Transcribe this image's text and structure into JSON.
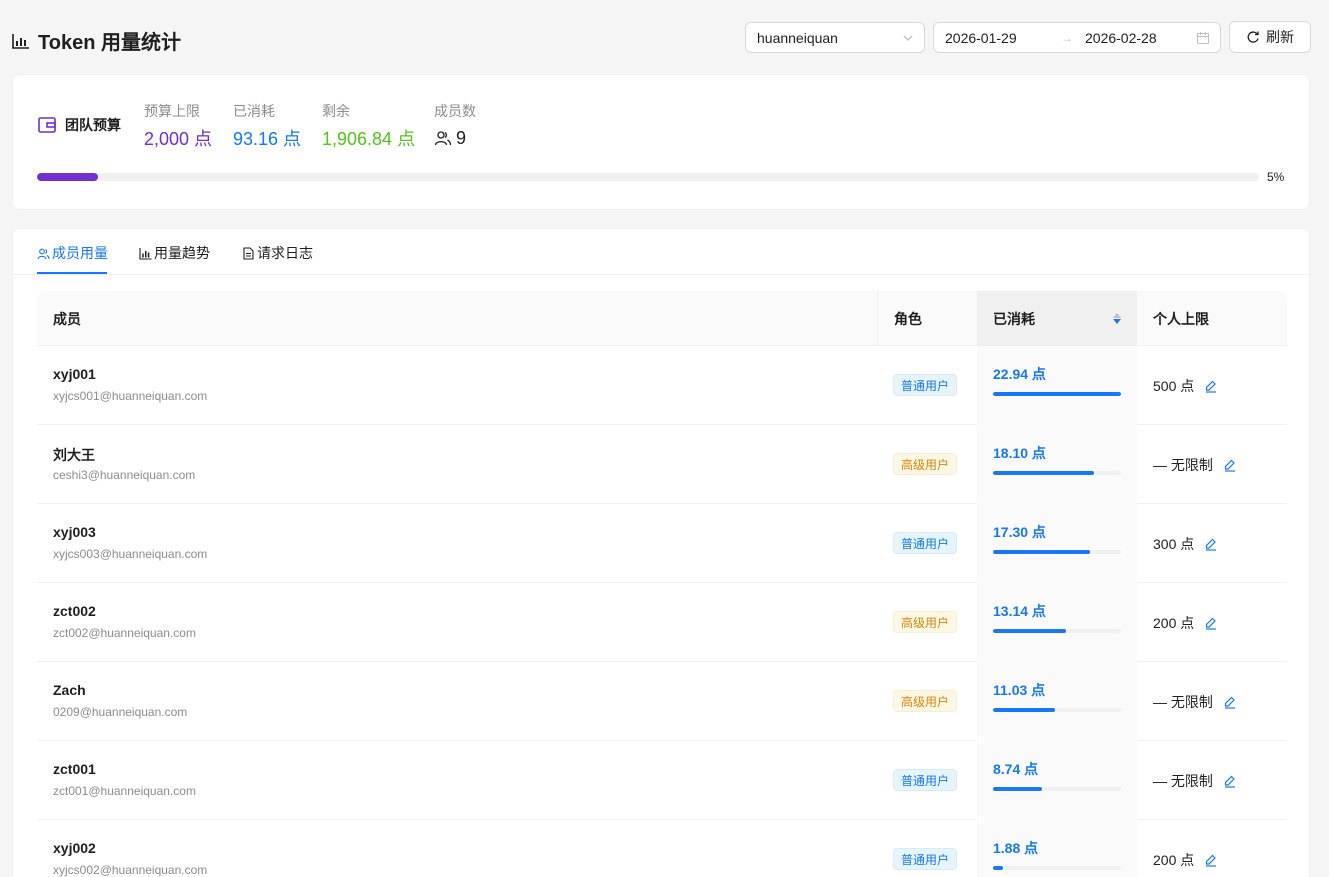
{
  "header": {
    "title": "Token 用量统计",
    "team_select": "huanneiquan",
    "date_start": "2026-01-29",
    "date_end": "2026-02-28",
    "refresh_label": "刷新"
  },
  "budget": {
    "label": "团队预算",
    "limit_label": "预算上限",
    "limit_value": "2,000 点",
    "used_label": "已消耗",
    "used_value": "93.16 点",
    "remain_label": "剩余",
    "remain_value": "1,906.84 点",
    "members_label": "成员数",
    "members_value": "9",
    "progress": 0.05,
    "progress_label": "5%",
    "colors": {
      "limit": "#722ed1",
      "used": "#1677ff",
      "remain": "#52c41a"
    }
  },
  "tabs": [
    {
      "label": "成员用量",
      "icon": "user-group-icon",
      "active": true
    },
    {
      "label": "用量趋势",
      "icon": "bar-chart-icon",
      "active": false
    },
    {
      "label": "请求日志",
      "icon": "file-text-icon",
      "active": false
    }
  ],
  "table": {
    "columns": {
      "member": "成员",
      "role": "角色",
      "used": "已消耗",
      "limit": "个人上限"
    },
    "rows": [
      {
        "name": "xyj001",
        "email": "xyjcs001@huanneiquan.com",
        "role": "普通用户",
        "role_type": "normal",
        "used": "22.94 点",
        "used_ratio": 1.0,
        "limit": "500 点"
      },
      {
        "name": "刘大王",
        "email": "ceshi3@huanneiquan.com",
        "role": "高级用户",
        "role_type": "senior",
        "used": "18.10 点",
        "used_ratio": 0.789,
        "limit": "— 无限制"
      },
      {
        "name": "xyj003",
        "email": "xyjcs003@huanneiquan.com",
        "role": "普通用户",
        "role_type": "normal",
        "used": "17.30 点",
        "used_ratio": 0.754,
        "limit": "300 点"
      },
      {
        "name": "zct002",
        "email": "zct002@huanneiquan.com",
        "role": "高级用户",
        "role_type": "senior",
        "used": "13.14 点",
        "used_ratio": 0.573,
        "limit": "200 点"
      },
      {
        "name": "Zach",
        "email": "0209@huanneiquan.com",
        "role": "高级用户",
        "role_type": "senior",
        "used": "11.03 点",
        "used_ratio": 0.481,
        "limit": "— 无限制"
      },
      {
        "name": "zct001",
        "email": "zct001@huanneiquan.com",
        "role": "普通用户",
        "role_type": "normal",
        "used": "8.74 点",
        "used_ratio": 0.381,
        "limit": "— 无限制"
      },
      {
        "name": "xyj002",
        "email": "xyjcs002@huanneiquan.com",
        "role": "普通用户",
        "role_type": "normal",
        "used": "1.88 点",
        "used_ratio": 0.082,
        "limit": "200 点"
      }
    ]
  }
}
